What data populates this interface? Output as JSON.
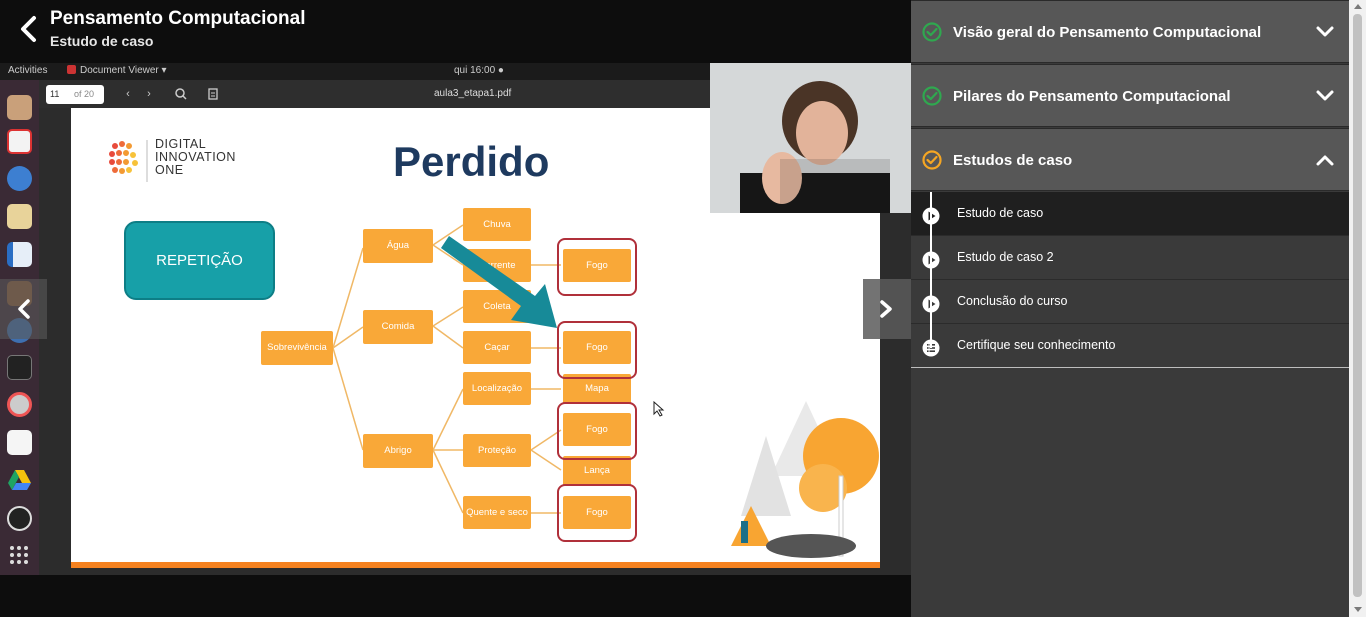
{
  "header": {
    "title": "Pensamento Computacional",
    "subtitle": "Estudo de caso"
  },
  "gnome": {
    "activities": "Activities",
    "app": "Document Viewer ▾",
    "clock": "qui 16:00 ●"
  },
  "viewer": {
    "page": "11",
    "of": "of 20",
    "filename": "aula3_etapa1.pdf"
  },
  "slide": {
    "logo_line1": "DIGITAL",
    "logo_line2": "INNOVATION",
    "logo_line3": "ONE",
    "title": "Perdido",
    "repeticao": "REPETIÇÃO",
    "nodes": {
      "root": "Sobrevivência",
      "agua": "Água",
      "comida": "Comida",
      "abrigo": "Abrigo",
      "chuva": "Chuva",
      "corrente": "Corrente",
      "coleta": "Coleta",
      "cacar": "Caçar",
      "localizacao": "Localização",
      "protecao": "Proteção",
      "quente": "Quente e seco",
      "fogo": "Fogo",
      "mapa": "Mapa",
      "lanca": "Lança"
    }
  },
  "sidebar": {
    "sections": [
      {
        "title": "Visão geral do Pensamento Computacional",
        "status": "complete"
      },
      {
        "title": "Pilares do Pensamento Computacional",
        "status": "complete"
      },
      {
        "title": "Estudos de caso",
        "status": "in-progress"
      }
    ],
    "lessons": [
      {
        "label": "Estudo de caso",
        "active": true
      },
      {
        "label": "Estudo de caso 2"
      },
      {
        "label": "Conclusão do curso"
      },
      {
        "label": "Certifique seu conhecimento"
      }
    ]
  },
  "colors": {
    "complete": "#2fa84f",
    "in_progress": "#f5a623",
    "slide_orange": "#f9a838",
    "teal": "#17a0a8",
    "title_navy": "#1e3a5f"
  }
}
